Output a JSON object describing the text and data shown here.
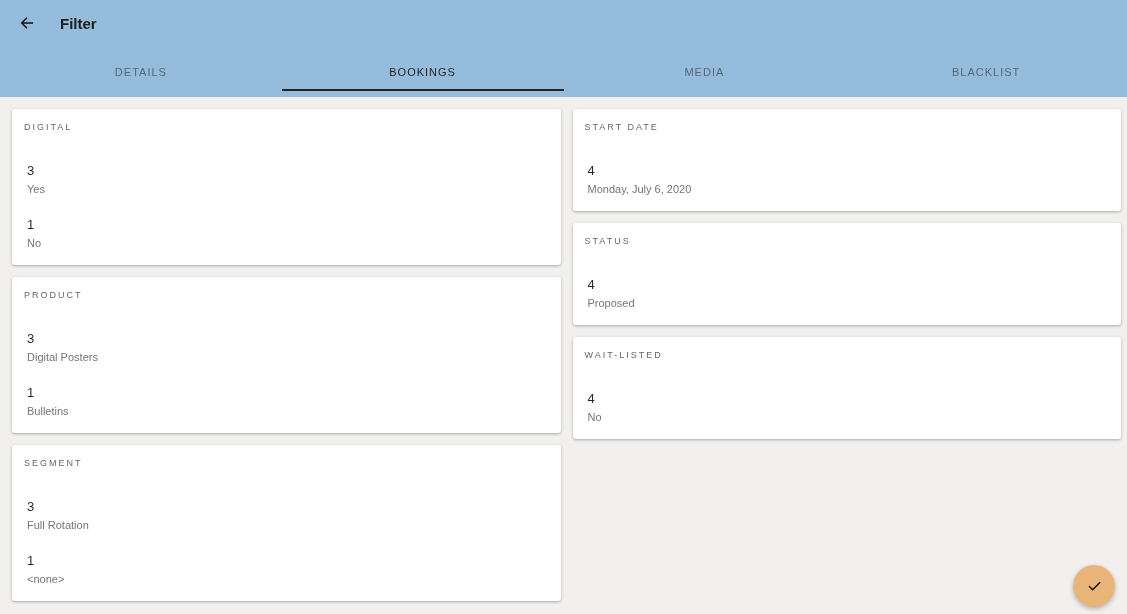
{
  "app_bar": {
    "title": "Filter"
  },
  "tabs": [
    {
      "label": "DETAILS",
      "selected": false
    },
    {
      "label": "BOOKINGS",
      "selected": true
    },
    {
      "label": "MEDIA",
      "selected": false
    },
    {
      "label": "BLACKLIST",
      "selected": false
    }
  ],
  "columns": [
    {
      "cards": [
        {
          "title": "DIGITAL",
          "entries": [
            {
              "count": "3",
              "label": "Yes"
            },
            {
              "count": "1",
              "label": "No"
            }
          ]
        },
        {
          "title": "PRODUCT",
          "entries": [
            {
              "count": "3",
              "label": "Digital Posters"
            },
            {
              "count": "1",
              "label": "Bulletins"
            }
          ]
        },
        {
          "title": "SEGMENT",
          "entries": [
            {
              "count": "3",
              "label": "Full Rotation"
            },
            {
              "count": "1",
              "label": "<none>"
            }
          ]
        }
      ]
    },
    {
      "cards": [
        {
          "title": "START DATE",
          "entries": [
            {
              "count": "4",
              "label": "Monday, July 6, 2020"
            }
          ]
        },
        {
          "title": "STATUS",
          "entries": [
            {
              "count": "4",
              "label": "Proposed"
            }
          ]
        },
        {
          "title": "WAIT-LISTED",
          "entries": [
            {
              "count": "4",
              "label": "No"
            }
          ]
        }
      ]
    }
  ]
}
